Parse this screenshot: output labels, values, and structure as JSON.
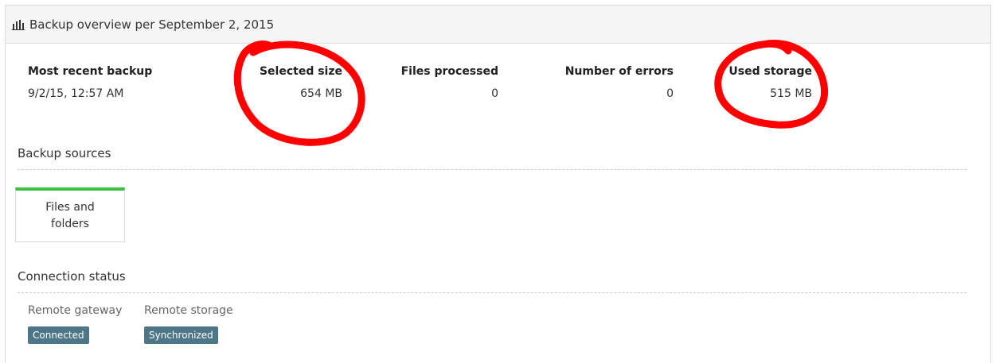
{
  "header": {
    "icon": "bar-chart-icon",
    "title": "Backup overview per September 2, 2015"
  },
  "summary": {
    "most_recent_backup": {
      "label": "Most recent backup",
      "value": "9/2/15, 12:57 AM"
    },
    "selected_size": {
      "label": "Selected size",
      "value": "654 MB"
    },
    "files_processed": {
      "label": "Files processed",
      "value": "0"
    },
    "number_of_errors": {
      "label": "Number of errors",
      "value": "0"
    },
    "used_storage": {
      "label": "Used storage",
      "value": "515 MB"
    }
  },
  "backup_sources": {
    "title": "Backup sources",
    "items": [
      {
        "label_line1": "Files and",
        "label_line2": "folders",
        "status_color": "#3ec13e"
      }
    ]
  },
  "connection_status": {
    "title": "Connection status",
    "remote_gateway": {
      "label": "Remote gateway",
      "status": "Connected"
    },
    "remote_storage": {
      "label": "Remote storage",
      "status": "Synchronized"
    }
  },
  "colors": {
    "badge": "#4d7789",
    "annotation": "#ff0000",
    "source_ok": "#3ec13e"
  }
}
